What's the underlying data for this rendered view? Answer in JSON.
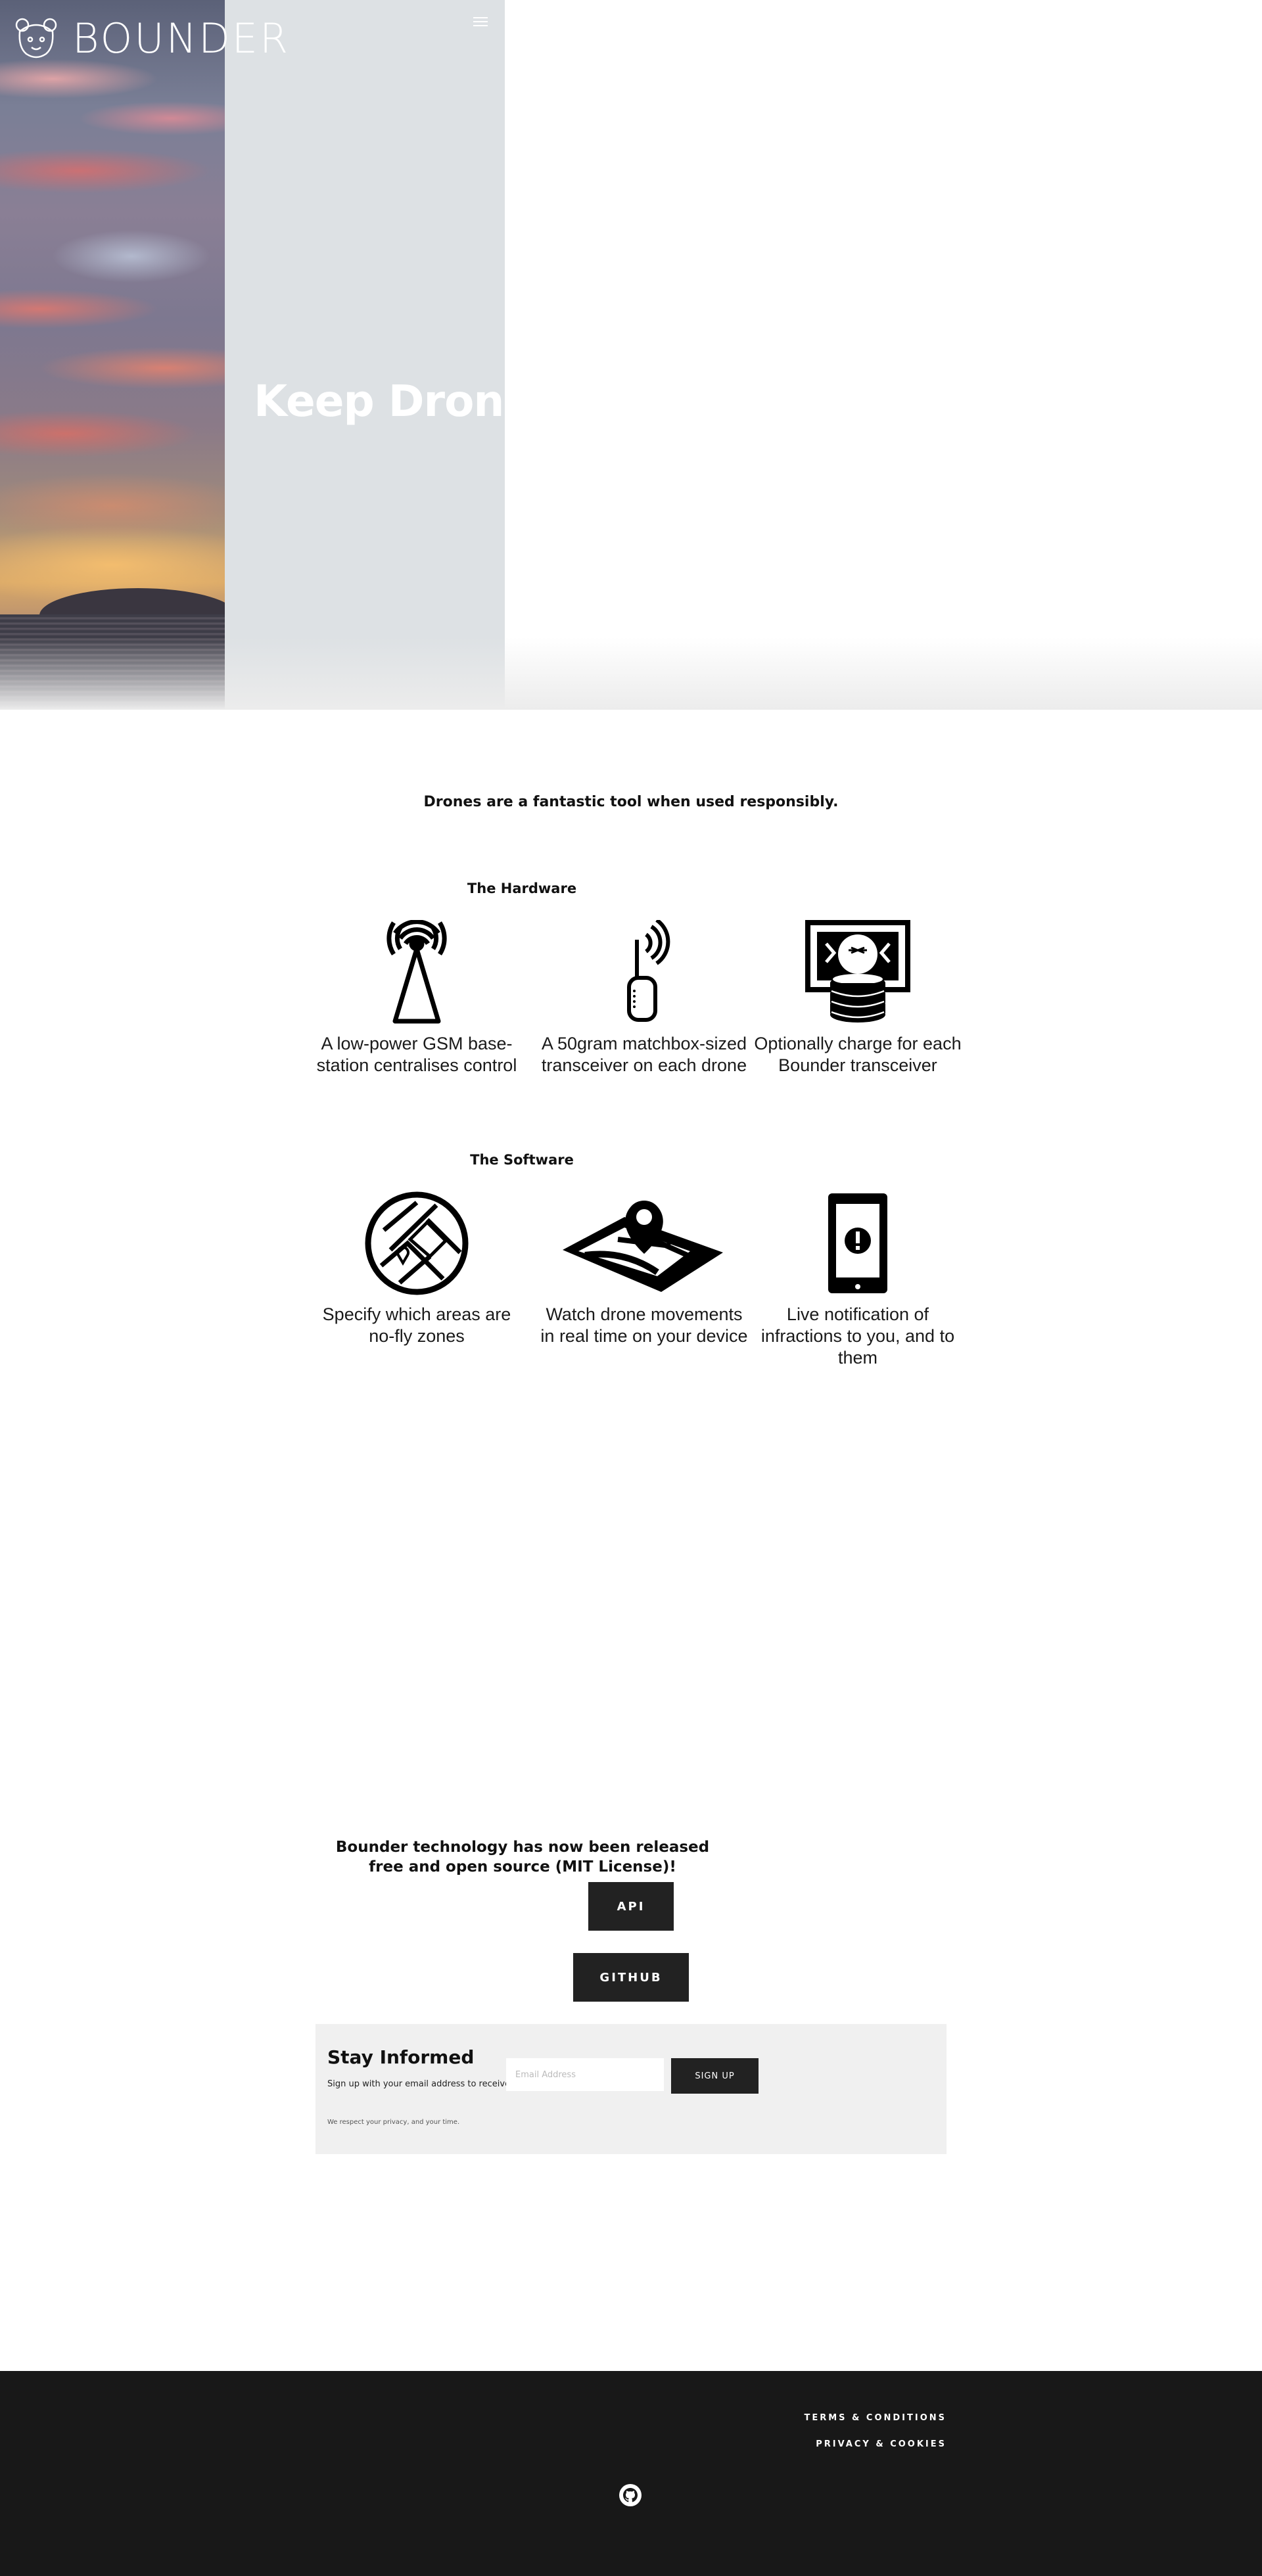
{
  "brand": {
    "name": "BOUNDER",
    "logo_icon": "bear-logo-icon"
  },
  "header": {
    "menu_icon": "hamburger-menu-icon"
  },
  "hero": {
    "headline": "Keep Drones"
  },
  "intro": {
    "text": "Drones are a fantastic tool when used responsibly."
  },
  "hardware": {
    "title": "The Hardware",
    "items": [
      {
        "icon": "cell-tower-icon",
        "text": "A low-power GSM base-station centralises control"
      },
      {
        "icon": "transceiver-icon",
        "text": "A 50gram matchbox-sized transceiver on each drone"
      },
      {
        "icon": "money-coins-icon",
        "text": "Optionally charge for each Bounder transceiver"
      }
    ]
  },
  "software": {
    "title": "The Software",
    "items": [
      {
        "icon": "no-fly-zone-map-icon",
        "text": "Specify which areas are no-fly zones"
      },
      {
        "icon": "map-location-pin-icon",
        "text": "Watch drone movements in real time on your device"
      },
      {
        "icon": "phone-alert-icon",
        "text": "Live notification of infractions to you, and to them"
      }
    ]
  },
  "release": {
    "text": "Bounder technology has now been released free and open source (MIT License)!",
    "api_label": "API",
    "github_label": "GITHUB"
  },
  "newsletter": {
    "title": "Stay Informed",
    "subtitle": "Sign up with your email address to receive important updates.",
    "email_placeholder": "Email Address",
    "button_label": "SIGN UP",
    "privacy": "We respect your privacy, and your time."
  },
  "footer": {
    "terms_label": "TERMS & CONDITIONS",
    "privacy_label": "PRIVACY & COOKIES",
    "social_icon": "github-icon"
  }
}
